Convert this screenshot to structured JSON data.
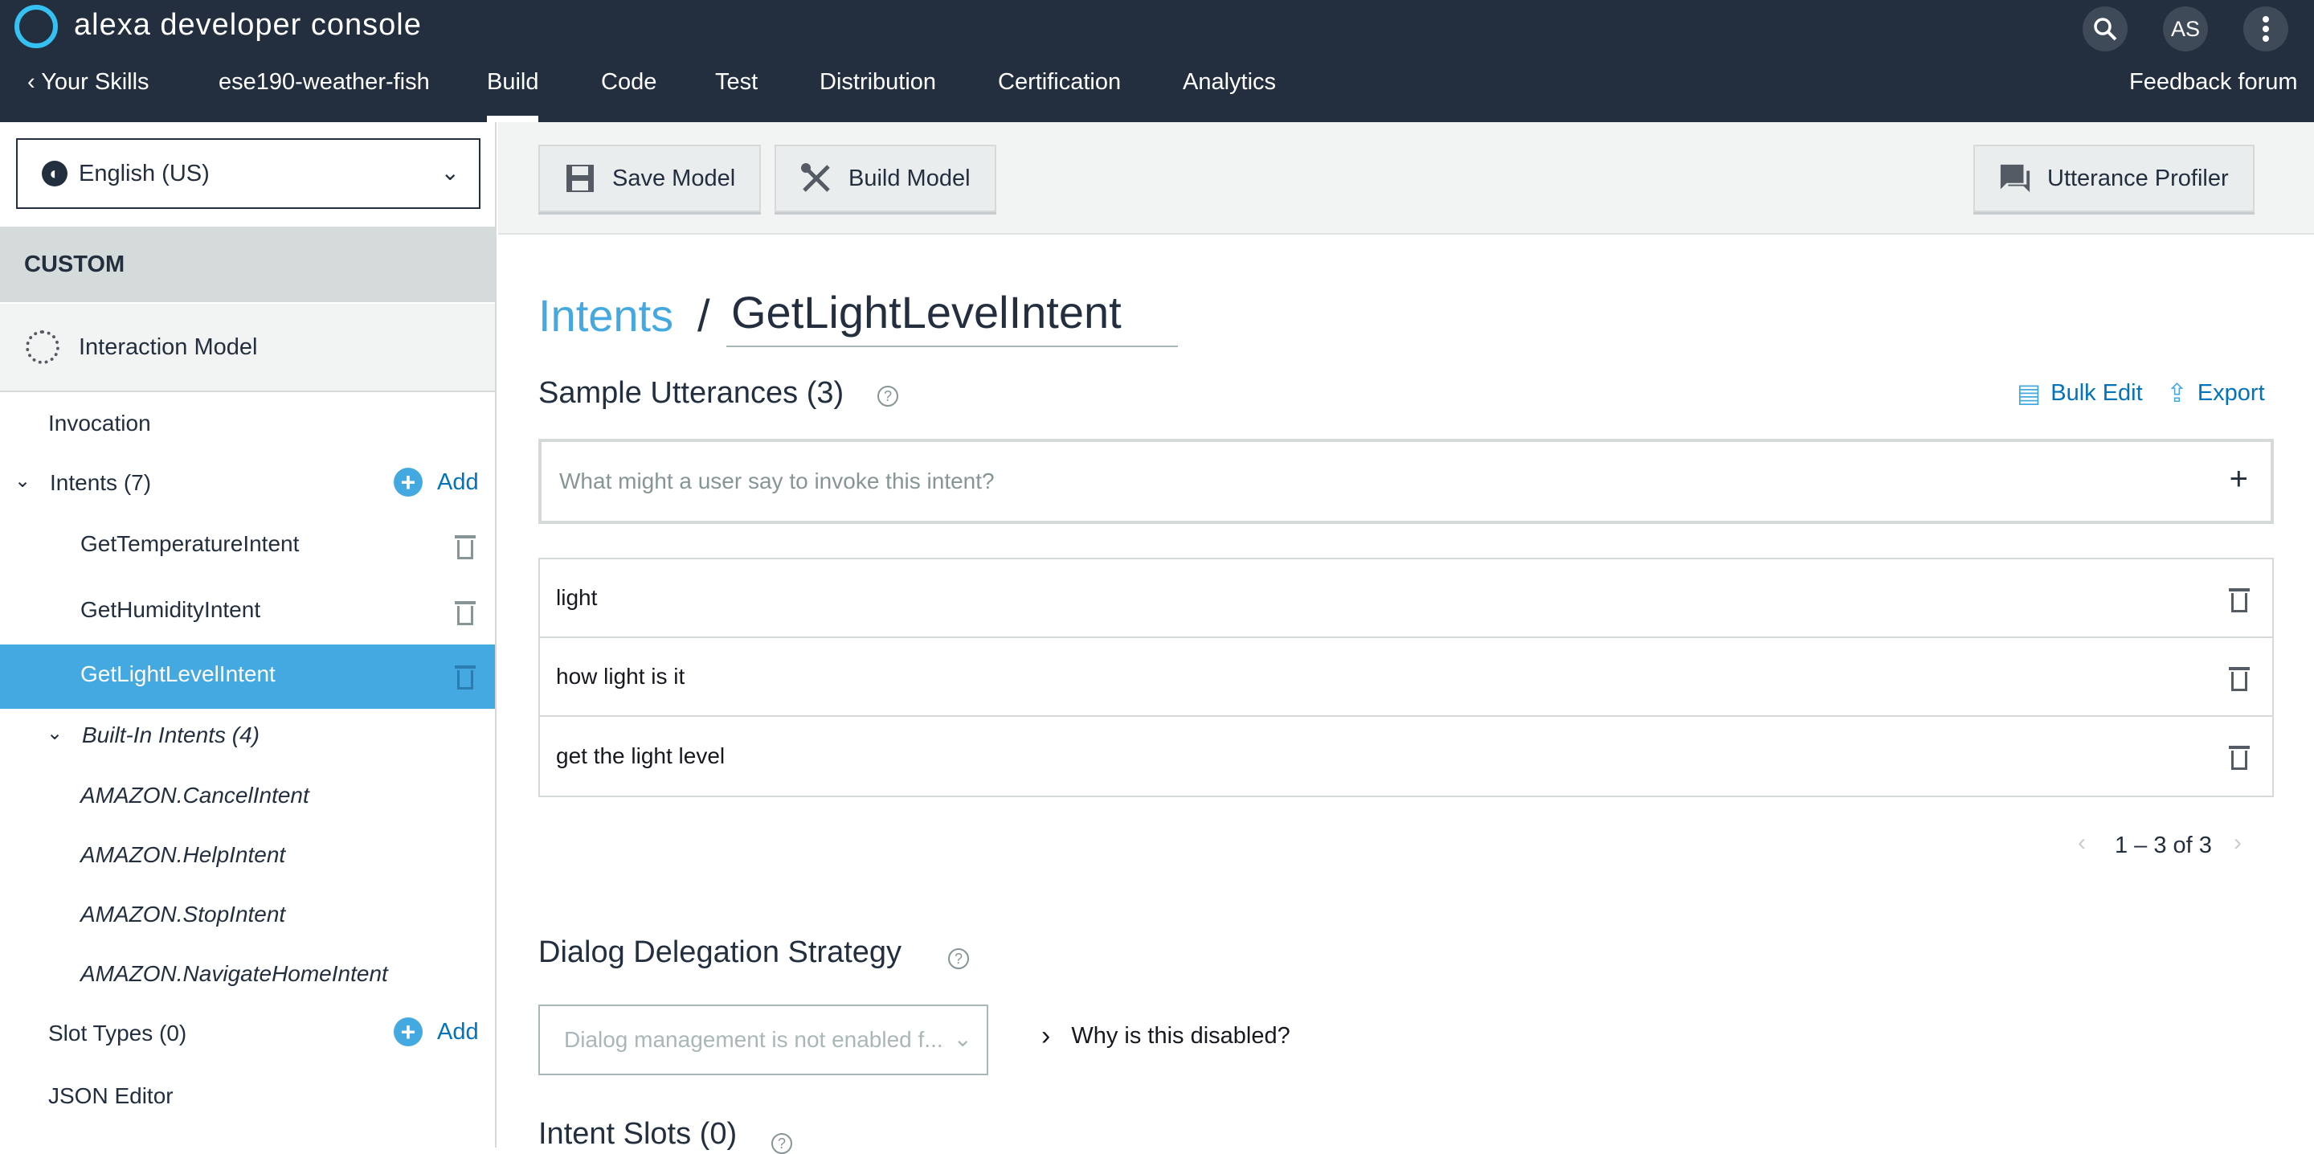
{
  "header": {
    "app_title": "alexa developer console",
    "search_icon": "search-icon",
    "avatar_initials": "AS",
    "more_icon": "more-vertical-icon",
    "nav": {
      "back_label": "Your Skills",
      "skill_name": "ese190-weather-fish",
      "tabs": [
        "Build",
        "Code",
        "Test",
        "Distribution",
        "Certification",
        "Analytics"
      ],
      "active_tab": "Build",
      "feedback": "Feedback forum"
    }
  },
  "sidebar": {
    "language": "English (US)",
    "section_label": "CUSTOM",
    "interaction_model": "Interaction Model",
    "invocation": "Invocation",
    "intents_label": "Intents (7)",
    "add_label": "Add",
    "custom_intents": [
      "GetTemperatureIntent",
      "GetHumidityIntent",
      "GetLightLevelIntent"
    ],
    "selected_intent": "GetLightLevelIntent",
    "builtin_label": "Built-In Intents (4)",
    "builtin_intents": [
      "AMAZON.CancelIntent",
      "AMAZON.HelpIntent",
      "AMAZON.StopIntent",
      "AMAZON.NavigateHomeIntent"
    ],
    "slot_types_label": "Slot Types (0)",
    "json_editor": "JSON Editor"
  },
  "toolbar": {
    "save_label": "Save Model",
    "build_label": "Build Model",
    "profiler_label": "Utterance Profiler"
  },
  "main": {
    "breadcrumb_link": "Intents",
    "breadcrumb_sep": "/",
    "intent_name": "GetLightLevelIntent",
    "utterances_title": "Sample Utterances (3)",
    "bulk_edit": "Bulk Edit",
    "export": "Export",
    "utterance_placeholder": "What might a user say to invoke this intent?",
    "utterances": [
      "light",
      "how light is it",
      "get the light level"
    ],
    "pager": "1 – 3 of 3",
    "dialog_title": "Dialog Delegation Strategy",
    "dialog_select": "Dialog management is not enabled f...",
    "why_disabled": "Why is this disabled?",
    "slots_title": "Intent Slots (0)"
  },
  "colors": {
    "header_bg": "#232f3e",
    "accent": "#44a9e1",
    "link": "#0073bb",
    "selected_row": "#44a9e1"
  }
}
